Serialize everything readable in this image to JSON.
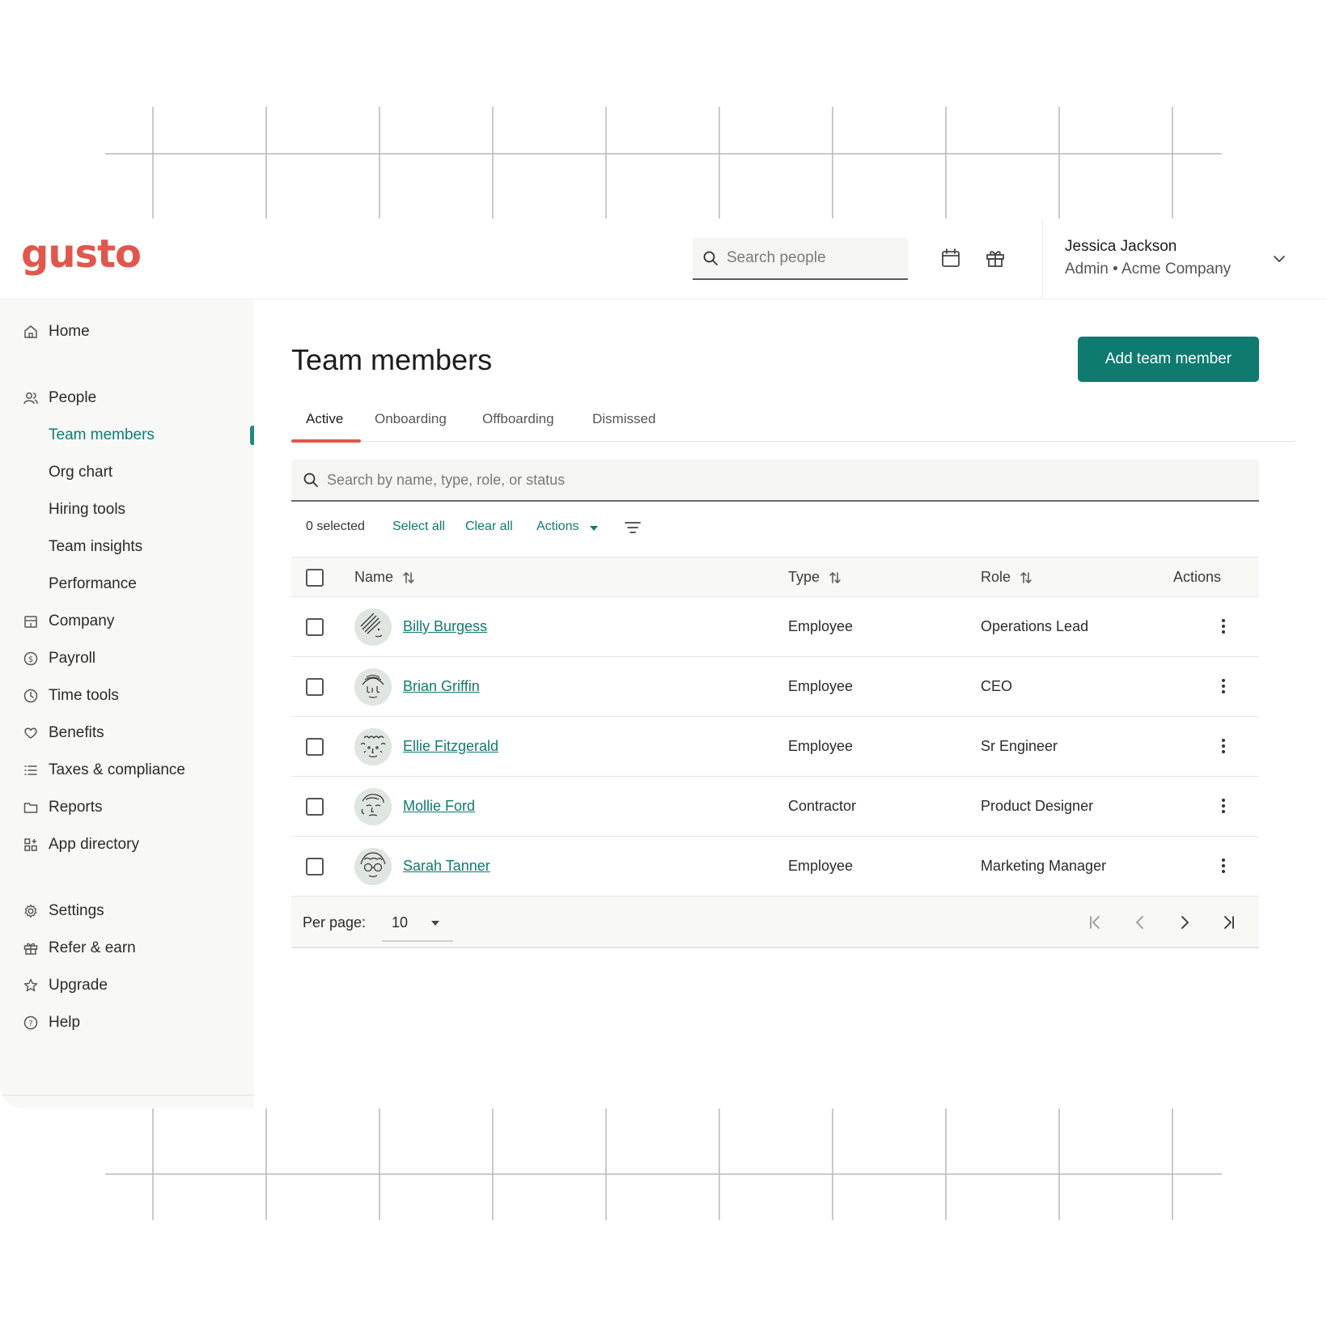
{
  "brand": {
    "logo_text": "gusto",
    "accent": "#e2574c",
    "primary": "#0f7a70"
  },
  "header": {
    "search_placeholder": "Search people",
    "calendar_icon": "calendar-icon",
    "gift_icon": "gift-icon",
    "user_name": "Jessica Jackson",
    "user_role": "Admin • Acme Company"
  },
  "sidebar": {
    "items": [
      {
        "label": "Home",
        "icon": "home-icon"
      },
      {
        "label": "People",
        "icon": "people-icon"
      },
      {
        "label": "Team members",
        "active": true
      },
      {
        "label": "Org chart"
      },
      {
        "label": "Hiring tools"
      },
      {
        "label": "Team insights"
      },
      {
        "label": "Performance"
      },
      {
        "label": "Company",
        "icon": "building-icon"
      },
      {
        "label": "Payroll",
        "icon": "dollar-icon"
      },
      {
        "label": "Time tools",
        "icon": "clock-icon"
      },
      {
        "label": "Benefits",
        "icon": "heart-icon"
      },
      {
        "label": "Taxes & compliance",
        "icon": "list-icon"
      },
      {
        "label": "Reports",
        "icon": "folder-icon"
      },
      {
        "label": "App directory",
        "icon": "apps-icon"
      },
      {
        "label": "Settings",
        "icon": "gear-icon"
      },
      {
        "label": "Refer & earn",
        "icon": "gift-icon"
      },
      {
        "label": "Upgrade",
        "icon": "star-icon"
      },
      {
        "label": "Help",
        "icon": "help-icon"
      }
    ]
  },
  "main": {
    "title": "Team members",
    "add_button": "Add team member",
    "tabs": [
      {
        "label": "Active",
        "active": true
      },
      {
        "label": "Onboarding"
      },
      {
        "label": "Offboarding"
      },
      {
        "label": "Dismissed"
      }
    ],
    "table_search_placeholder": "Search by name, type, role, or status",
    "bulk": {
      "selected": "0 selected",
      "select_all": "Select all",
      "clear_all": "Clear all",
      "actions": "Actions"
    },
    "columns": {
      "name": "Name",
      "type": "Type",
      "role": "Role",
      "actions": "Actions"
    },
    "rows": [
      {
        "name": "Billy Burgess",
        "type": "Employee",
        "role": "Operations Lead"
      },
      {
        "name": "Brian Griffin",
        "type": "Employee",
        "role": "CEO"
      },
      {
        "name": "Ellie Fitzgerald",
        "type": "Employee",
        "role": "Sr Engineer"
      },
      {
        "name": "Mollie Ford",
        "type": "Contractor",
        "role": "Product Designer"
      },
      {
        "name": "Sarah Tanner",
        "type": "Employee",
        "role": "Marketing Manager"
      }
    ],
    "footer": {
      "per_page_label": "Per page:",
      "per_page_value": "10"
    }
  }
}
